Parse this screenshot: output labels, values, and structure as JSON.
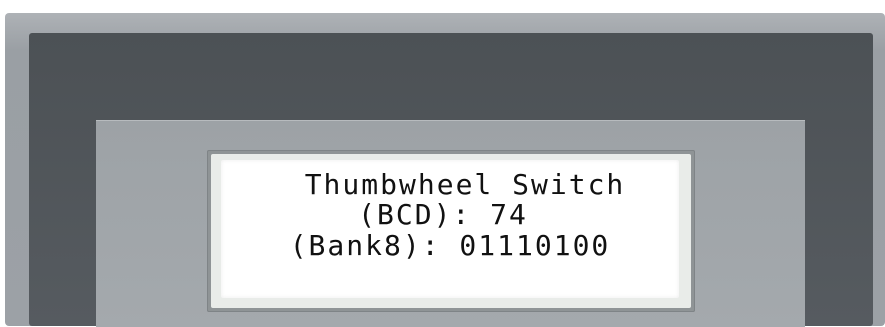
{
  "display": {
    "lines": [
      "Thumbwheel Switch",
      "(BCD): 74",
      "(Bank8): 01110100"
    ]
  },
  "colors": {
    "bezel": "#9ca1a6",
    "frame": "#52575b",
    "lcd_background": "#ffffff",
    "lcd_text": "#111111"
  }
}
